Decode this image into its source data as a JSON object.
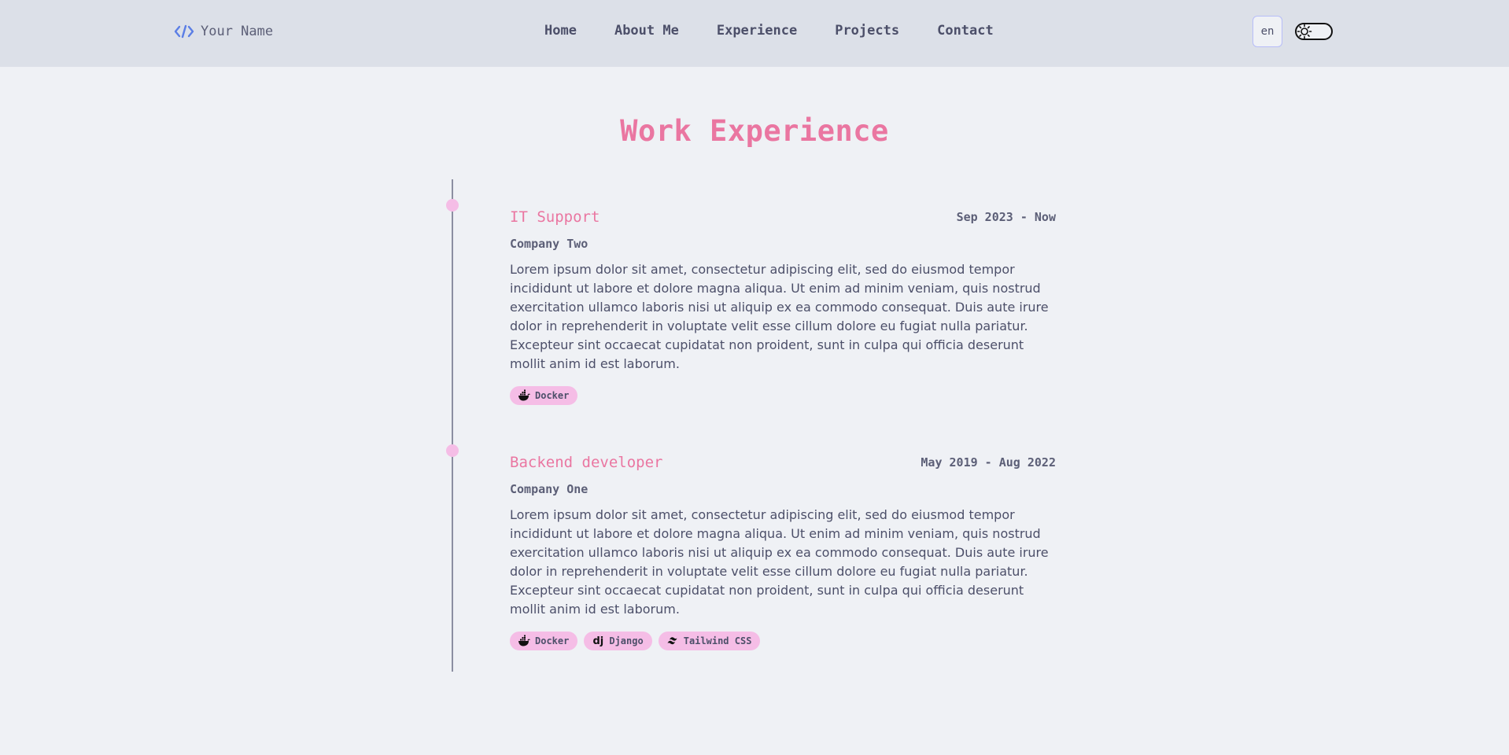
{
  "brand": {
    "name": "Your Name",
    "icon": "code-icon",
    "icon_color": "#5b7ee5"
  },
  "nav": [
    "Home",
    "About Me",
    "Experience",
    "Projects",
    "Contact"
  ],
  "header": {
    "language": "en",
    "theme_toggle_icon": "sun-icon"
  },
  "section": {
    "title": "Work Experience"
  },
  "jobs": [
    {
      "title": "IT Support",
      "date": "Sep 2023 - Now",
      "company": "Company Two",
      "description": "Lorem ipsum dolor sit amet, consectetur adipiscing elit, sed do eiusmod tempor incididunt ut labore et dolore magna aliqua. Ut enim ad minim veniam, quis nostrud exercitation ullamco laboris nisi ut aliquip ex ea commodo consequat. Duis aute irure dolor in reprehenderit in voluptate velit esse cillum dolore eu fugiat nulla pariatur. Excepteur sint occaecat cupidatat non proident, sunt in culpa qui officia deserunt mollit anim id est laborum.",
      "tags": [
        {
          "label": "Docker",
          "icon": "docker-icon"
        }
      ]
    },
    {
      "title": "Backend developer",
      "date": "May 2019 - Aug 2022",
      "company": "Company One",
      "description": "Lorem ipsum dolor sit amet, consectetur adipiscing elit, sed do eiusmod tempor incididunt ut labore et dolore magna aliqua. Ut enim ad minim veniam, quis nostrud exercitation ullamco laboris nisi ut aliquip ex ea commodo consequat. Duis aute irure dolor in reprehenderit in voluptate velit esse cillum dolore eu fugiat nulla pariatur. Excepteur sint occaecat cupidatat non proident, sunt in culpa qui officia deserunt mollit anim id est laborum.",
      "tags": [
        {
          "label": "Docker",
          "icon": "docker-icon"
        },
        {
          "label": "Django",
          "icon": "django-icon",
          "icon_text": "dj"
        },
        {
          "label": "Tailwind CSS",
          "icon": "tailwind-icon"
        }
      ]
    }
  ],
  "colors": {
    "background": "#eff1f5",
    "header": "#dce0e8",
    "accent": "#ea76a1",
    "tag": "#f5bde6",
    "text": "#4c4f69"
  }
}
